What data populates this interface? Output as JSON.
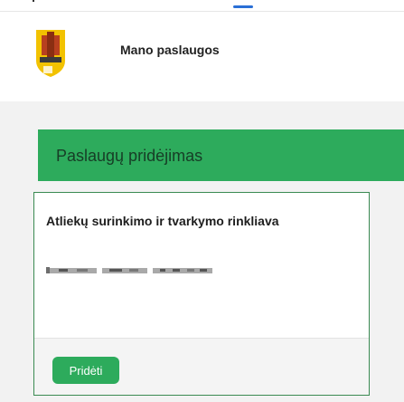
{
  "header": {
    "title": "Mano paslaugos",
    "logo_icon": "coat-of-arms-icon"
  },
  "section": {
    "title": "Paslaugų pridėjimas"
  },
  "card": {
    "title": "Atliekų surinkimo ir tvarkymo rinkliava",
    "description_redacted": true,
    "add_button_label": "Pridėti"
  },
  "colors": {
    "accent_green": "#2dab5c",
    "card_border": "#3a8a52",
    "page_background": "#f2f2f2"
  }
}
